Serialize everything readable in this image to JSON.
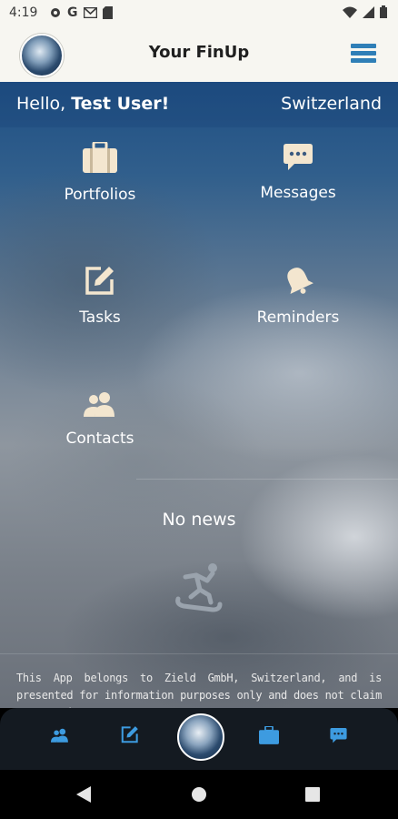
{
  "status_bar": {
    "time": "4:19",
    "left_icons": [
      "settings-icon",
      "google-icon",
      "gmail-icon",
      "sd-card-icon"
    ],
    "right_icons": [
      "wifi-icon",
      "signal-icon",
      "battery-icon"
    ]
  },
  "header": {
    "title": "Your FinUp",
    "logo_icon": "earth-logo",
    "menu_icon": "hamburger-menu-icon"
  },
  "greeting": {
    "prefix": "Hello, ",
    "user": "Test User!",
    "country": "Switzerland"
  },
  "tiles": [
    {
      "label": "Portfolios",
      "icon": "briefcase-icon"
    },
    {
      "label": "Messages",
      "icon": "message-icon"
    },
    {
      "label": "Tasks",
      "icon": "edit-icon"
    },
    {
      "label": "Reminders",
      "icon": "bell-icon"
    },
    {
      "label": "Contacts",
      "icon": "contacts-icon"
    }
  ],
  "news": {
    "empty_text": "No news",
    "icon": "snowboarder-icon"
  },
  "disclaimer": "This App belongs to Zield GmbH, Switzerland, and is presented for information purposes only and does not claim to contain a",
  "bottom_nav": [
    "contacts-icon",
    "edit-icon",
    "earth-logo",
    "briefcase-icon",
    "message-icon"
  ],
  "colors": {
    "accent": "#2f7fb7",
    "tile_icon": "#f3e6cf",
    "nav_icon": "#3d9be0",
    "header_bg": "#f7f6f1"
  }
}
